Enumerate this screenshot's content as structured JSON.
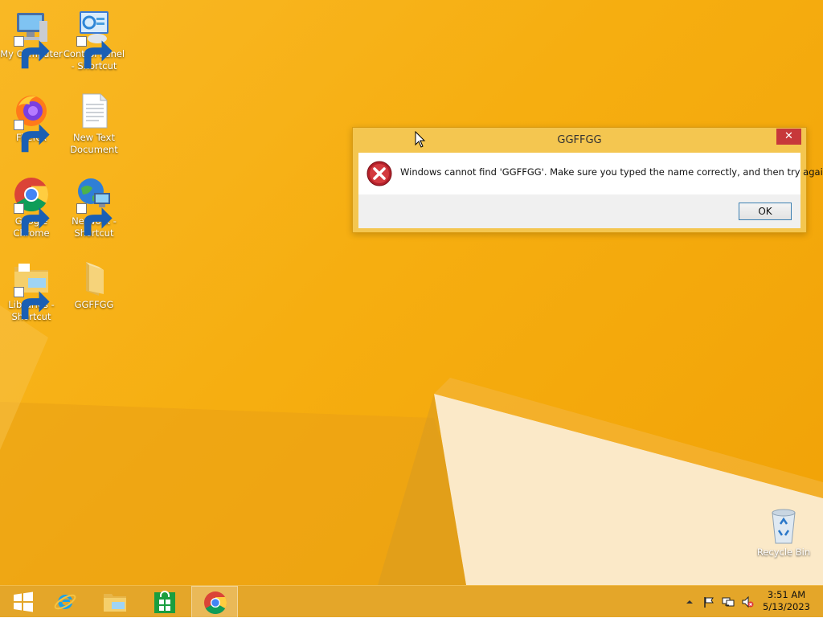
{
  "desktop": {
    "icons": [
      {
        "label": "My Computer"
      },
      {
        "label": "Control Panel - Shortcut"
      },
      {
        "label": "Firefox"
      },
      {
        "label": "New Text Document"
      },
      {
        "label": "Google Chrome"
      },
      {
        "label": "Network - Shortcut"
      },
      {
        "label": "Libraries - Shortcut"
      },
      {
        "label": "GGFFGG"
      },
      {
        "label": "Recycle Bin"
      }
    ]
  },
  "dialog": {
    "title": "GGFFGG",
    "close_label": "✕",
    "message": "Windows cannot find 'GGFFGG'. Make sure you typed the name correctly, and then try again.",
    "ok_label": "OK"
  },
  "taskbar": {
    "items": [
      "start-icon",
      "internet-explorer-icon",
      "file-explorer-icon",
      "store-icon",
      "chrome-icon"
    ],
    "tray": {
      "time": "3:51 AM",
      "date": "5/13/2023"
    }
  },
  "colors": {
    "desktop_bg": "#f6ae10",
    "taskbar_bg": "#e4a629",
    "dialog_frame": "#f4c650",
    "close_button": "#c7383a",
    "error_red": "#b3202a"
  }
}
